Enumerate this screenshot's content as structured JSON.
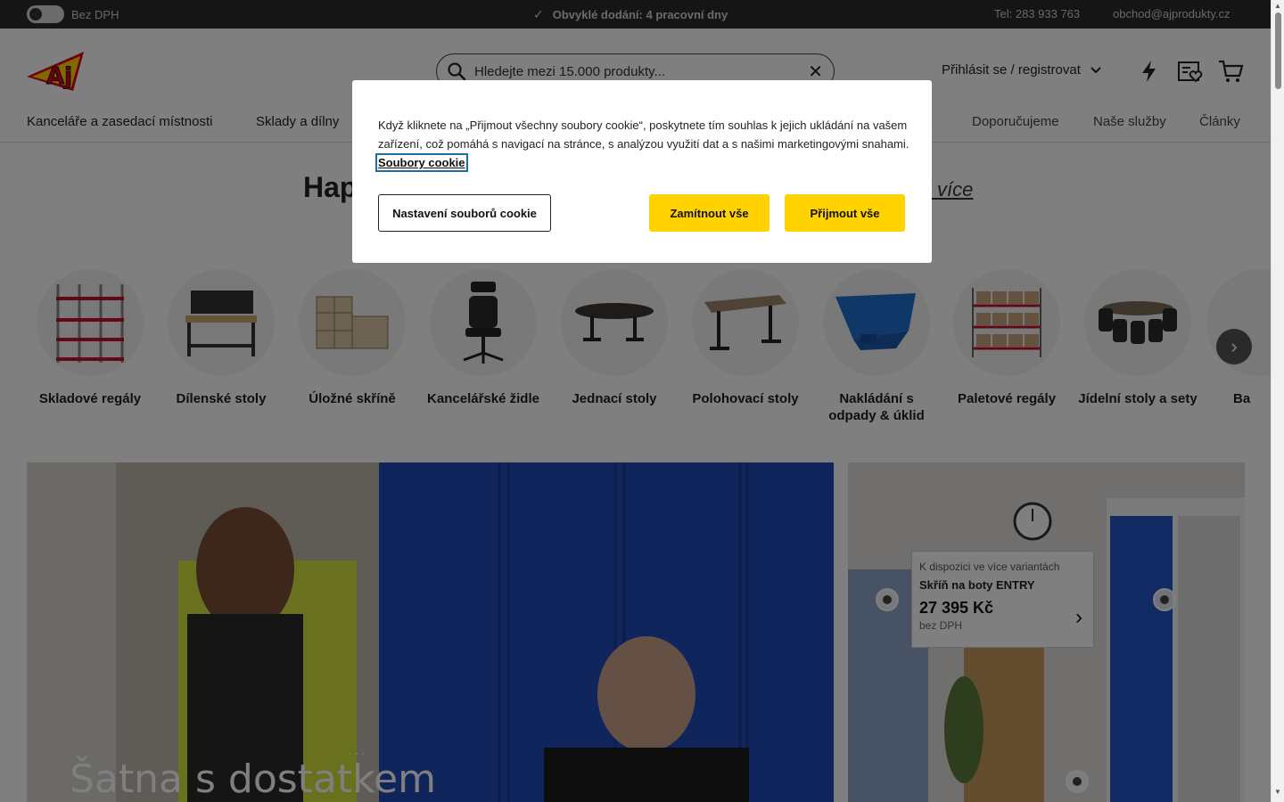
{
  "colors": {
    "topbar": "#2b2b2b",
    "accent": "#ffd200",
    "focus": "#1b6fa8"
  },
  "topbar": {
    "vat_label": "Bez DPH",
    "delivery": "Obvyklé dodání: 4 pracovní dny",
    "phone": "Tel: 283 933 763",
    "email": "obchod@ajprodukty.cz"
  },
  "header": {
    "search_placeholder": "Hledejte mezi 15.000 produkty...",
    "login": "Přihlásit se / registrovat",
    "icons": [
      "lightning-icon",
      "wishlist-icon",
      "cart-icon"
    ]
  },
  "nav": {
    "items": [
      "Kanceláře a zasedací místnosti",
      "Sklady a dílny"
    ],
    "right": [
      "Doporučujeme",
      "Naše služby",
      "Články"
    ]
  },
  "page": {
    "heading": "Hap",
    "more": "i více"
  },
  "categories": [
    {
      "label": "Skladové regály"
    },
    {
      "label": "Dílenské stoly"
    },
    {
      "label": "Úložné skříně"
    },
    {
      "label": "Kancelářské židle"
    },
    {
      "label": "Jednací stoly"
    },
    {
      "label": "Polohovací stoly"
    },
    {
      "label": "Nakládání s odpady & úklid"
    },
    {
      "label": "Paletové regály"
    },
    {
      "label": "Jídelní stoly a sety"
    },
    {
      "label": "Ba"
    }
  ],
  "hero": {
    "left_title": "Šatna s dostatkem",
    "dots": "···"
  },
  "product_popup": {
    "variant": "K dispozici ve více variantách",
    "name": "Skříň na boty ENTRY",
    "price": "27 395 Kč",
    "vat": "bez DPH"
  },
  "cookie": {
    "text": "Když kliknete na „Přijmout všechny soubory cookie“, poskytnete tím souhlas k jejich ukládání na vašem zařízení, což pomáhá s navigací na stránce, s analýzou využití dat a s našimi marketingovými snahami.",
    "link": "Soubory cookie",
    "settings": "Nastavení souborů cookie",
    "reject": "Zamítnout vše",
    "accept": "Přijmout vše"
  }
}
